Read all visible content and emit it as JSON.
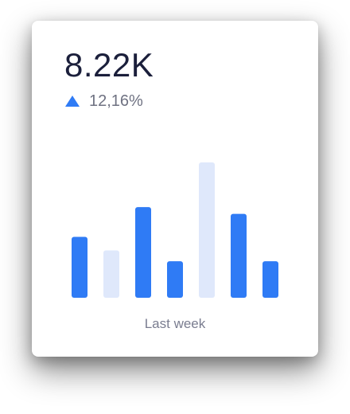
{
  "widget": {
    "value": "8.22K",
    "change": "12,16%",
    "trend_icon": "triangle-up-icon",
    "period": "Last week"
  },
  "colors": {
    "primary_bar": "#2f7bf5",
    "muted_bar": "#dfe8fb",
    "value_text": "#1b1f3b",
    "secondary_text": "#6f7282"
  },
  "chart_data": {
    "type": "bar",
    "categories": [
      "",
      "",
      "",
      "",
      "",
      "",
      ""
    ],
    "values": [
      0.45,
      0.35,
      0.67,
      0.27,
      1.0,
      0.62,
      0.27
    ],
    "highlight": [
      true,
      false,
      true,
      true,
      false,
      true,
      true
    ],
    "title": "",
    "xlabel": "Last week",
    "ylabel": "",
    "grid": false,
    "legend": "none"
  }
}
